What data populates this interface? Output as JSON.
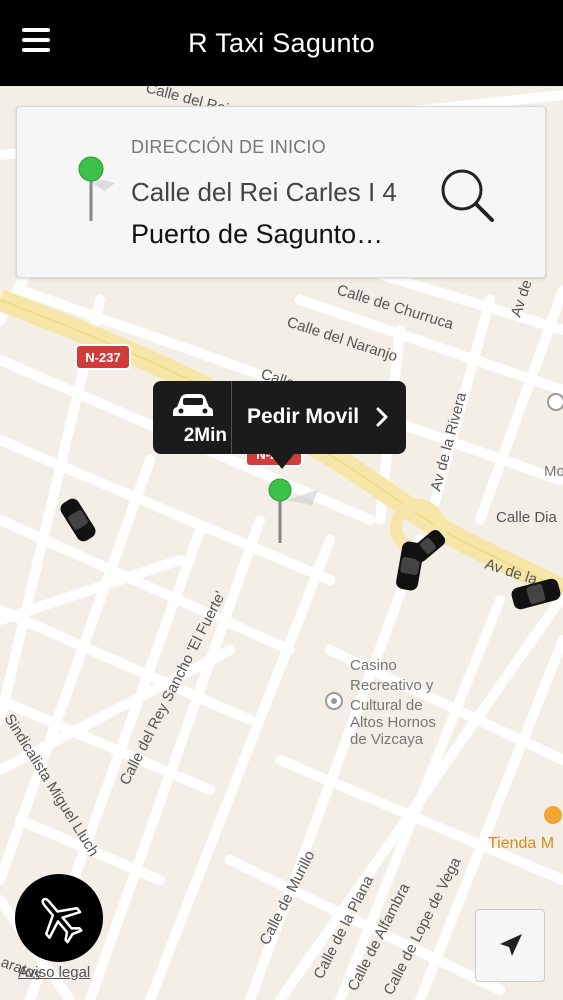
{
  "header": {
    "title": "R Taxi Sagunto",
    "menu_icon": "hamburger-menu-icon"
  },
  "address_card": {
    "caption": "DIRECCIÓN DE INICIO",
    "street": "Calle del Rei Carles I 4",
    "city": "Puerto de Sagunto…",
    "pin_color": "#3cc24a",
    "search_icon": "search-icon"
  },
  "callout": {
    "eta": "2Min",
    "action": "Pedir Movil",
    "car_icon": "taxi-car-icon"
  },
  "map": {
    "road_badges": [
      "N-237",
      "N-237"
    ],
    "streets": [
      "Calle del Rei",
      "Calle de Churruca",
      "Calle del Naranjo",
      "Calle Almir",
      "Av de la Rivera",
      "Av de la Riv",
      "Calle Dia",
      "Av de la",
      "Calle del Rey Sancho 'El Fuerte'",
      "Sindicalista Miguel Lluch",
      "Calle de Murillo",
      "Calle de la Plana",
      "Calle de Alfambra",
      "Calle de Lope de Vega",
      "aratos"
    ],
    "pois": [
      "Casino",
      "Recreativo y",
      "Cultural de",
      "Altos Hornos",
      "de Vizcaya",
      "Tienda M",
      "Mo"
    ]
  },
  "airport_button": {
    "icon": "airplane-icon"
  },
  "legal_link": "Aviso legal",
  "locate_button": {
    "icon": "location-arrow-icon"
  }
}
